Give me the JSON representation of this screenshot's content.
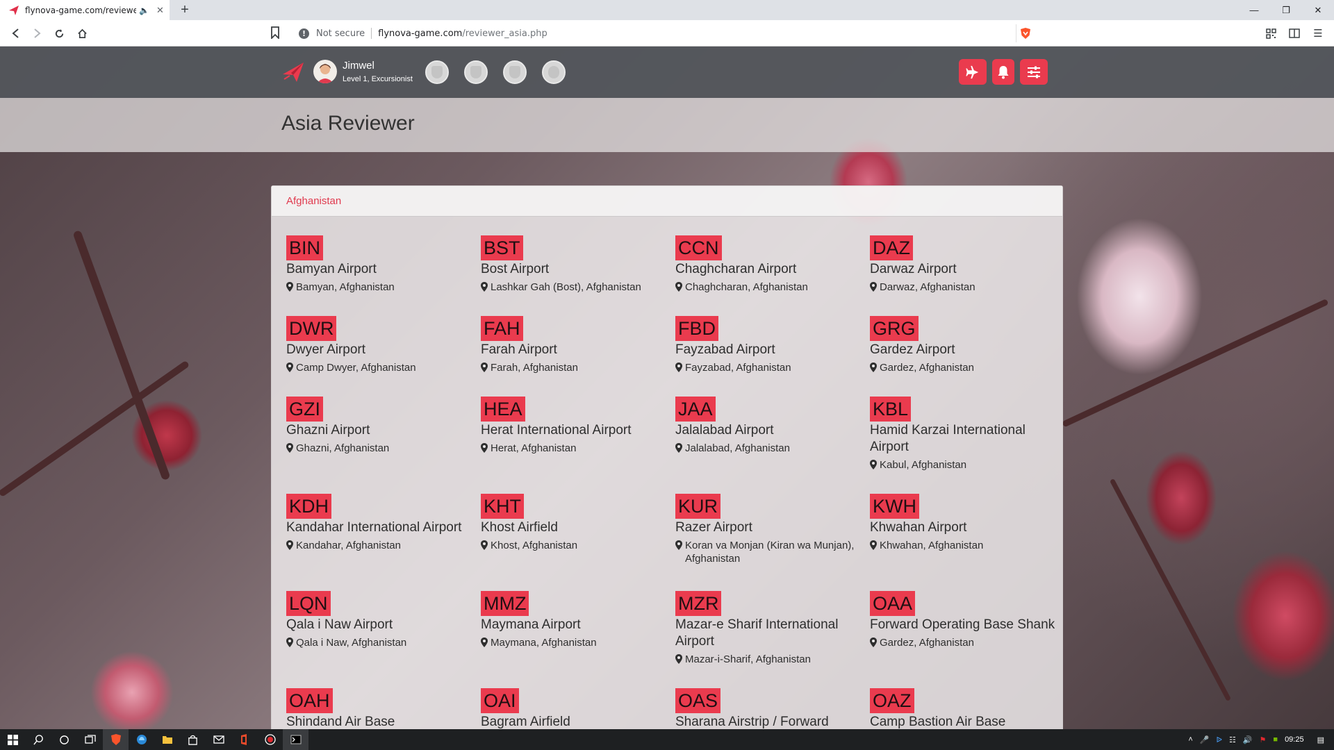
{
  "browser": {
    "tab_title": "flynova-game.com/reviewer_a",
    "new_tab": "+",
    "not_secure": "Not secure",
    "url_host": "flynova-game.com",
    "url_path": "/reviewer_asia.php"
  },
  "header": {
    "user_name": "Jimwel",
    "user_level": "Level 1, Excursionist"
  },
  "page": {
    "title": "Asia Reviewer",
    "country": "Afghanistan"
  },
  "airports": [
    [
      {
        "code": "BIN",
        "name": "Bamyan Airport",
        "location": "Bamyan, Afghanistan"
      },
      {
        "code": "BST",
        "name": "Bost Airport",
        "location": "Lashkar Gah (Bost), Afghanistan"
      },
      {
        "code": "CCN",
        "name": "Chaghcharan Airport",
        "location": "Chaghcharan, Afghanistan"
      },
      {
        "code": "DAZ",
        "name": "Darwaz Airport",
        "location": "Darwaz, Afghanistan"
      }
    ],
    [
      {
        "code": "DWR",
        "name": "Dwyer Airport",
        "location": "Camp Dwyer, Afghanistan"
      },
      {
        "code": "FAH",
        "name": "Farah Airport",
        "location": "Farah, Afghanistan"
      },
      {
        "code": "FBD",
        "name": "Fayzabad Airport",
        "location": "Fayzabad, Afghanistan"
      },
      {
        "code": "GRG",
        "name": "Gardez Airport",
        "location": "Gardez, Afghanistan"
      }
    ],
    [
      {
        "code": "GZI",
        "name": "Ghazni Airport",
        "location": "Ghazni, Afghanistan"
      },
      {
        "code": "HEA",
        "name": "Herat International Airport",
        "location": "Herat, Afghanistan"
      },
      {
        "code": "JAA",
        "name": "Jalalabad Airport",
        "location": "Jalalabad, Afghanistan"
      },
      {
        "code": "KBL",
        "name": "Hamid Karzai International Airport",
        "location": "Kabul, Afghanistan"
      }
    ],
    [
      {
        "code": "KDH",
        "name": "Kandahar International Airport",
        "location": "Kandahar, Afghanistan"
      },
      {
        "code": "KHT",
        "name": "Khost Airfield",
        "location": "Khost, Afghanistan"
      },
      {
        "code": "KUR",
        "name": "Razer Airport",
        "location": "Koran va Monjan (Kiran wa Munjan), Afghanistan"
      },
      {
        "code": "KWH",
        "name": "Khwahan Airport",
        "location": "Khwahan, Afghanistan"
      }
    ],
    [
      {
        "code": "LQN",
        "name": "Qala i Naw Airport",
        "location": "Qala i Naw, Afghanistan"
      },
      {
        "code": "MMZ",
        "name": "Maymana Airport",
        "location": "Maymana, Afghanistan"
      },
      {
        "code": "MZR",
        "name": "Mazar-e Sharif International Airport",
        "location": "Mazar-i-Sharif, Afghanistan"
      },
      {
        "code": "OAA",
        "name": "Forward Operating Base Shank",
        "location": "Gardez, Afghanistan"
      }
    ],
    [
      {
        "code": "OAH",
        "name": "Shindand Air Base",
        "location": ""
      },
      {
        "code": "OAI",
        "name": "Bagram Airfield",
        "location": ""
      },
      {
        "code": "OAS",
        "name": "Sharana Airstrip / Forward",
        "location": ""
      },
      {
        "code": "OAZ",
        "name": "Camp Bastion Air Base",
        "location": ""
      }
    ]
  ],
  "taskbar": {
    "clock": "09:25"
  },
  "colors": {
    "accent": "#ea3b4e",
    "topbar": "#53565c"
  }
}
